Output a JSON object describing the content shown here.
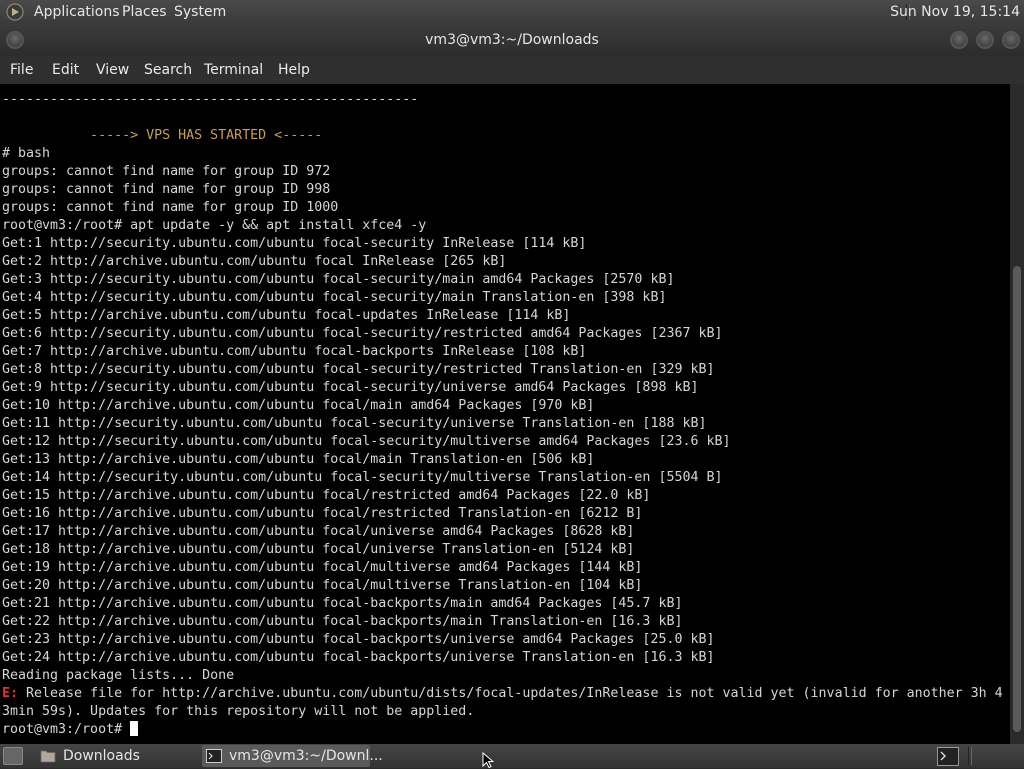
{
  "top_panel": {
    "menus": [
      "Applications",
      "Places",
      "System"
    ],
    "clock": "Sun Nov 19, 15:14"
  },
  "window": {
    "title": "vm3@vm3:~/Downloads"
  },
  "menubar": {
    "items": [
      "File",
      "Edit",
      "View",
      "Search",
      "Terminal",
      "Help"
    ]
  },
  "terminal": {
    "lines": [
      "----------------------------------------------------",
      "",
      "           -----> VPS HAS STARTED <-----",
      "# bash",
      "groups: cannot find name for group ID 972",
      "groups: cannot find name for group ID 998",
      "groups: cannot find name for group ID 1000",
      "root@vm3:/root# apt update -y && apt install xfce4 -y",
      "Get:1 http://security.ubuntu.com/ubuntu focal-security InRelease [114 kB]",
      "Get:2 http://archive.ubuntu.com/ubuntu focal InRelease [265 kB]",
      "Get:3 http://security.ubuntu.com/ubuntu focal-security/main amd64 Packages [2570 kB]",
      "Get:4 http://security.ubuntu.com/ubuntu focal-security/main Translation-en [398 kB]",
      "Get:5 http://archive.ubuntu.com/ubuntu focal-updates InRelease [114 kB]",
      "Get:6 http://security.ubuntu.com/ubuntu focal-security/restricted amd64 Packages [2367 kB]",
      "Get:7 http://archive.ubuntu.com/ubuntu focal-backports InRelease [108 kB]",
      "Get:8 http://security.ubuntu.com/ubuntu focal-security/restricted Translation-en [329 kB]",
      "Get:9 http://security.ubuntu.com/ubuntu focal-security/universe amd64 Packages [898 kB]",
      "Get:10 http://archive.ubuntu.com/ubuntu focal/main amd64 Packages [970 kB]",
      "Get:11 http://security.ubuntu.com/ubuntu focal-security/universe Translation-en [188 kB]",
      "Get:12 http://security.ubuntu.com/ubuntu focal-security/multiverse amd64 Packages [23.6 kB]",
      "Get:13 http://archive.ubuntu.com/ubuntu focal/main Translation-en [506 kB]",
      "Get:14 http://security.ubuntu.com/ubuntu focal-security/multiverse Translation-en [5504 B]",
      "Get:15 http://archive.ubuntu.com/ubuntu focal/restricted amd64 Packages [22.0 kB]",
      "Get:16 http://archive.ubuntu.com/ubuntu focal/restricted Translation-en [6212 B]",
      "Get:17 http://archive.ubuntu.com/ubuntu focal/universe amd64 Packages [8628 kB]",
      "Get:18 http://archive.ubuntu.com/ubuntu focal/universe Translation-en [5124 kB]",
      "Get:19 http://archive.ubuntu.com/ubuntu focal/multiverse amd64 Packages [144 kB]",
      "Get:20 http://archive.ubuntu.com/ubuntu focal/multiverse Translation-en [104 kB]",
      "Get:21 http://archive.ubuntu.com/ubuntu focal-backports/main amd64 Packages [45.7 kB]",
      "Get:22 http://archive.ubuntu.com/ubuntu focal-backports/main Translation-en [16.3 kB]",
      "Get:23 http://archive.ubuntu.com/ubuntu focal-backports/universe amd64 Packages [25.0 kB]",
      "Get:24 http://archive.ubuntu.com/ubuntu focal-backports/universe Translation-en [16.3 kB]",
      "Reading package lists... Done"
    ],
    "error_prefix": "E:",
    "error_line_1": " Release file for http://archive.ubuntu.com/ubuntu/dists/focal-updates/InRelease is not valid yet (invalid for another 3h 4",
    "error_line_2": "3min 59s). Updates for this repository will not be applied.",
    "prompt": "root@vm3:/root# "
  },
  "taskbar": {
    "tasks": [
      "Downloads",
      "vm3@vm3:~/Downl..."
    ]
  },
  "colors": {
    "banner": "#c9a04a",
    "error": "#e03030"
  }
}
